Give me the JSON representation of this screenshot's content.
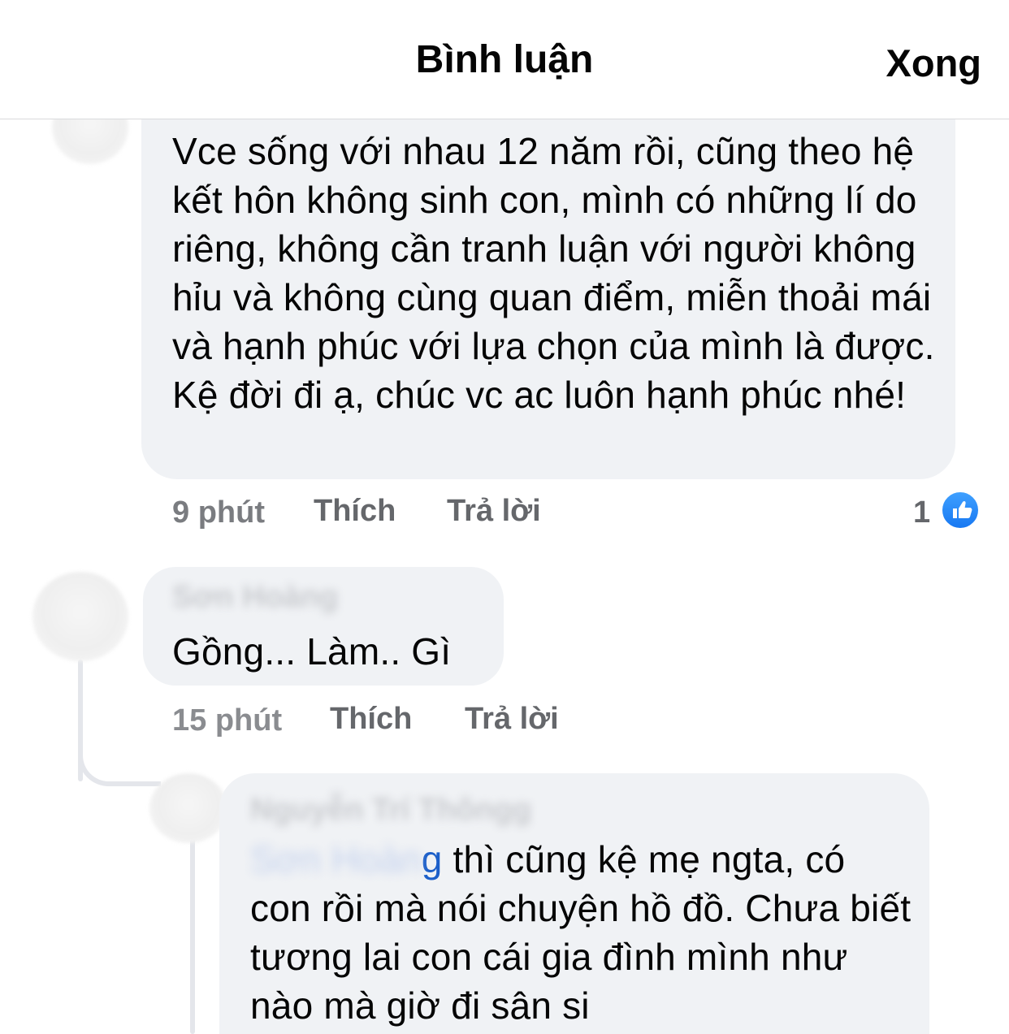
{
  "header": {
    "title": "Bình luận",
    "done_label": "Xong"
  },
  "comments": [
    {
      "text": "Vce sống với nhau 12 năm rồi, cũng theo hệ kết hôn không sinh con, mình có những lí do riêng, không cần tranh luận với người không hỉu và không cùng quan điểm, miễn thoải mái và hạnh phúc với lựa chọn của mình là được. Kệ đời đi ạ, chúc vc ac luôn hạnh phúc nhé!",
      "time": "9 phút",
      "like_label": "Thích",
      "reply_label": "Trả lời",
      "reaction_count": "1",
      "reaction_icon": "like-icon"
    },
    {
      "author": "Sơn Hoàng",
      "text": "Gồng... Làm.. Gì",
      "time": "15 phút",
      "like_label": "Thích",
      "reply_label": "Trả lời"
    },
    {
      "author": "Nguyễn Trí Thôngg",
      "mention_blurred": "Sơn Hoàn",
      "mention_visible": "g",
      "text": " thì cũng kệ mẹ ngta, có con rồi mà nói chuyện hồ đồ. Chưa biết tương lai con cái gia đình mình như nào mà giờ đi sân si"
    }
  ],
  "colors": {
    "bubble": "#f0f2f5",
    "meta_text": "#65676b",
    "like_blue": "#1778f2",
    "mention_blue": "#1c5fc9"
  }
}
